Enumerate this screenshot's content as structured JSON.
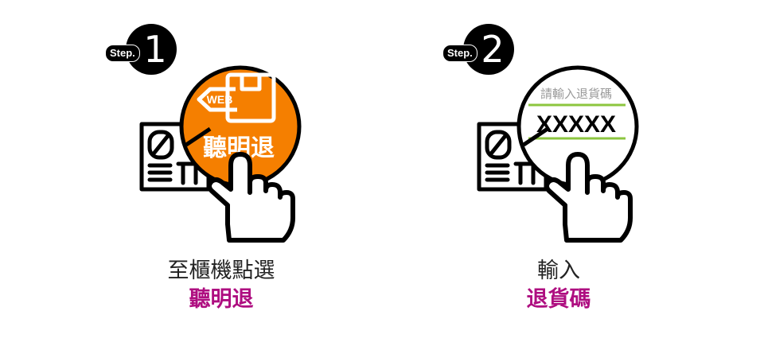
{
  "steps": [
    {
      "tag": "Step.",
      "number": "1",
      "button_text": "聽明退",
      "web_label": "WEB",
      "caption_line1": "至櫃機點選",
      "caption_line2": "聽明退"
    },
    {
      "tag": "Step.",
      "number": "2",
      "input_label": "請輸入退貨碼",
      "input_value": "XXXXX",
      "caption_line1": "輸入",
      "caption_line2": "退貨碼"
    }
  ],
  "colors": {
    "accent_orange": "#f57f00",
    "caption_highlight": "#ae0e80",
    "input_underline": "#8cc63f"
  }
}
